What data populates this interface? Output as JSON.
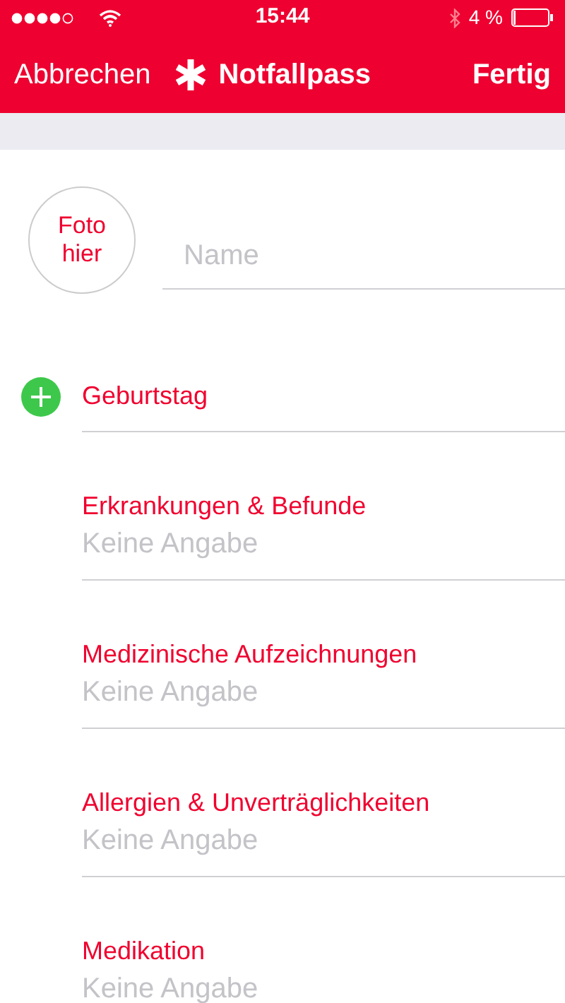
{
  "status_bar": {
    "time": "15:44",
    "battery": "4 %"
  },
  "nav": {
    "cancel": "Abbrechen",
    "title": "Notfallpass",
    "done": "Fertig"
  },
  "photo": {
    "label": "Foto hier"
  },
  "name_field": {
    "placeholder": "Name"
  },
  "birthday": {
    "label": "Geburtstag"
  },
  "sections": [
    {
      "label": "Erkrankungen & Befunde",
      "placeholder": "Keine Angabe"
    },
    {
      "label": "Medizinische Aufzeichnungen",
      "placeholder": "Keine Angabe"
    },
    {
      "label": "Allergien & Unverträglichkeiten",
      "placeholder": "Keine Angabe"
    },
    {
      "label": "Medikation",
      "placeholder": "Keine Angabe"
    }
  ]
}
